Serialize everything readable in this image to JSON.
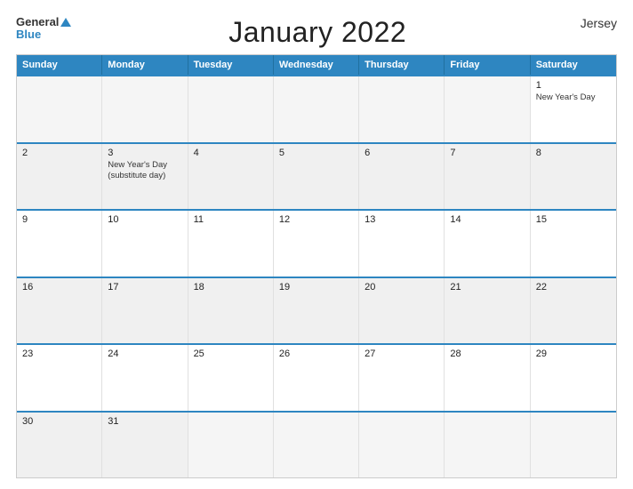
{
  "logo": {
    "general": "General",
    "blue": "Blue"
  },
  "title": "January 2022",
  "country": "Jersey",
  "days_header": [
    "Sunday",
    "Monday",
    "Tuesday",
    "Wednesday",
    "Thursday",
    "Friday",
    "Saturday"
  ],
  "weeks": [
    [
      {
        "day": "",
        "empty": true
      },
      {
        "day": "",
        "empty": true
      },
      {
        "day": "",
        "empty": true
      },
      {
        "day": "",
        "empty": true
      },
      {
        "day": "",
        "empty": true
      },
      {
        "day": "",
        "empty": true
      },
      {
        "day": "1",
        "event": "New Year's Day"
      }
    ],
    [
      {
        "day": "2",
        "shaded": true
      },
      {
        "day": "3",
        "event": "New Year's Day\n(substitute day)",
        "shaded": true
      },
      {
        "day": "4",
        "shaded": true
      },
      {
        "day": "5",
        "shaded": true
      },
      {
        "day": "6",
        "shaded": true
      },
      {
        "day": "7",
        "shaded": true
      },
      {
        "day": "8",
        "shaded": true
      }
    ],
    [
      {
        "day": "9"
      },
      {
        "day": "10"
      },
      {
        "day": "11"
      },
      {
        "day": "12"
      },
      {
        "day": "13"
      },
      {
        "day": "14"
      },
      {
        "day": "15"
      }
    ],
    [
      {
        "day": "16",
        "shaded": true
      },
      {
        "day": "17",
        "shaded": true
      },
      {
        "day": "18",
        "shaded": true
      },
      {
        "day": "19",
        "shaded": true
      },
      {
        "day": "20",
        "shaded": true
      },
      {
        "day": "21",
        "shaded": true
      },
      {
        "day": "22",
        "shaded": true
      }
    ],
    [
      {
        "day": "23"
      },
      {
        "day": "24"
      },
      {
        "day": "25"
      },
      {
        "day": "26"
      },
      {
        "day": "27"
      },
      {
        "day": "28"
      },
      {
        "day": "29"
      }
    ],
    [
      {
        "day": "30",
        "shaded": true
      },
      {
        "day": "31",
        "shaded": true
      },
      {
        "day": "",
        "empty": true,
        "shaded": true
      },
      {
        "day": "",
        "empty": true,
        "shaded": true
      },
      {
        "day": "",
        "empty": true,
        "shaded": true
      },
      {
        "day": "",
        "empty": true,
        "shaded": true
      },
      {
        "day": "",
        "empty": true,
        "shaded": true
      }
    ]
  ],
  "colors": {
    "header_bg": "#2e86c1",
    "accent": "#2e86c1"
  }
}
